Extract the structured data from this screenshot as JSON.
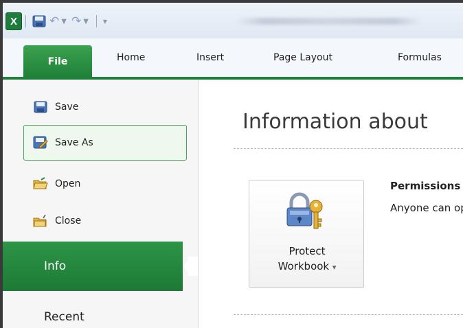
{
  "qat": {
    "app_icon_letter": "X",
    "icons": [
      "excel-icon",
      "save-icon",
      "undo-icon",
      "redo-icon",
      "customize-qat-icon"
    ]
  },
  "tabs": [
    {
      "label": "File"
    },
    {
      "label": "Home"
    },
    {
      "label": "Insert"
    },
    {
      "label": "Page Layout"
    },
    {
      "label": "Formulas"
    }
  ],
  "nav": {
    "save": "Save",
    "save_as": "Save As",
    "open": "Open",
    "close": "Close",
    "info": "Info",
    "recent": "Recent"
  },
  "main": {
    "title": "Information about",
    "protect_line1": "Protect",
    "protect_line2": "Workbook",
    "protect_dropdown_glyph": "▾",
    "permissions_title": "Permissions",
    "permissions_desc": "Anyone can open, copy, and change any part of this workbook."
  },
  "colors": {
    "file_tab": "#2a8f43",
    "info_selected": "#2a8f43",
    "save_as_border": "#49a25a"
  }
}
